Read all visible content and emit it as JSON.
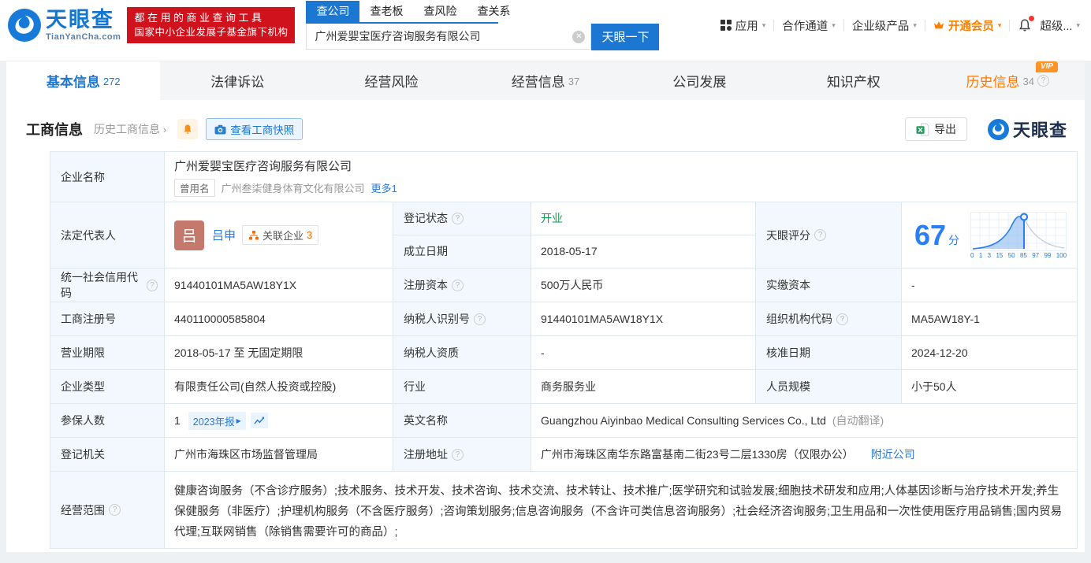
{
  "ui": {
    "caret": "▾",
    "arrow": "›",
    "qmark": "?",
    "clear": "✕",
    "vip": "VIP",
    "dash": "-"
  },
  "header": {
    "logo_text": "天眼查",
    "logo_sub": "TianYanCha.com",
    "promo_line1": "都在用的商业查询工具",
    "promo_line2": "国家中小企业发展子基金旗下机构",
    "search_tabs": [
      "查公司",
      "查老板",
      "查风险",
      "查关系"
    ],
    "search_value": "广州爱婴宝医疗咨询服务有限公司",
    "search_button": "天眼一下",
    "menu": [
      "应用",
      "合作通道",
      "企业级产品",
      "开通会员",
      "超级..."
    ]
  },
  "nav_tabs": [
    {
      "label": "基本信息",
      "count": "272"
    },
    {
      "label": "法律诉讼",
      "count": ""
    },
    {
      "label": "经营风险",
      "count": ""
    },
    {
      "label": "经营信息",
      "count": "37"
    },
    {
      "label": "公司发展",
      "count": ""
    },
    {
      "label": "知识产权",
      "count": ""
    },
    {
      "label": "历史信息",
      "count": "34"
    }
  ],
  "section": {
    "title": "工商信息",
    "history_link": "历史工商信息",
    "snapshot_button": "查看工商快照",
    "export_button": "导出",
    "watermark": "天眼查"
  },
  "info": {
    "company_name_label": "企业名称",
    "company_name": "广州爱婴宝医疗咨询服务有限公司",
    "former_tag": "曾用名",
    "former_name": "广州叁柒健身体育文化有限公司",
    "more_link": "更多1",
    "legal_rep_label": "法定代表人",
    "avatar_char": "吕",
    "legal_rep": "吕申",
    "related_label": "关联企业",
    "related_count": "3",
    "reg_status_label": "登记状态",
    "reg_status": "开业",
    "est_date_label": "成立日期",
    "est_date": "2018-05-17",
    "score_label": "天眼评分",
    "credit_code_label": "统一社会信用代码",
    "credit_code": "91440101MA5AW18Y1X",
    "reg_capital_label": "注册资本",
    "reg_capital": "500万人民币",
    "paid_capital_label": "实缴资本",
    "paid_capital": "-",
    "reg_number_label": "工商注册号",
    "reg_number": "440110000585804",
    "taxpayer_id_label": "纳税人识别号",
    "taxpayer_id": "91440101MA5AW18Y1X",
    "org_code_label": "组织机构代码",
    "org_code": "MA5AW18Y-1",
    "biz_term_label": "营业期限",
    "biz_term": "2018-05-17 至 无固定期限",
    "taxpayer_qual_label": "纳税人资质",
    "taxpayer_qual": "-",
    "approval_date_label": "核准日期",
    "approval_date": "2024-12-20",
    "company_type_label": "企业类型",
    "company_type": "有限责任公司(自然人投资或控股)",
    "industry_label": "行业",
    "industry": "商务服务业",
    "staff_size_label": "人员规模",
    "staff_size": "小于50人",
    "insured_label": "参保人数",
    "insured": "1",
    "annual_report_tag": "2023年报",
    "english_name_label": "英文名称",
    "english_name": "Guangzhou Aiyinbao Medical Consulting Services Co., Ltd",
    "auto_translate": "(自动翻译)",
    "reg_authority_label": "登记机关",
    "reg_authority": "广州市海珠区市场监督管理局",
    "address_label": "注册地址",
    "address": "广州市海珠区南华东路富基南二街23号二层1330房（仅限办公）",
    "nearby_link": "附近公司",
    "scope_label": "经营范围",
    "scope": "健康咨询服务（不含诊疗服务）;技术服务、技术开发、技术咨询、技术交流、技术转让、技术推广;医学研究和试验发展;细胞技术研发和应用;人体基因诊断与治疗技术开发;养生保健服务（非医疗）;护理机构服务（不含医疗服务）;咨询策划服务;信息咨询服务（不含许可类信息咨询服务）;社会经济咨询服务;卫生用品和一次性使用医疗用品销售;国内贸易代理;互联网销售（除销售需要许可的商品）;"
  },
  "score": {
    "value": "67",
    "unit": "分",
    "axis": [
      "0",
      "1",
      "3",
      "15",
      "50",
      "85",
      "97",
      "99",
      "100"
    ],
    "accent_color": "#2a7ff6"
  }
}
